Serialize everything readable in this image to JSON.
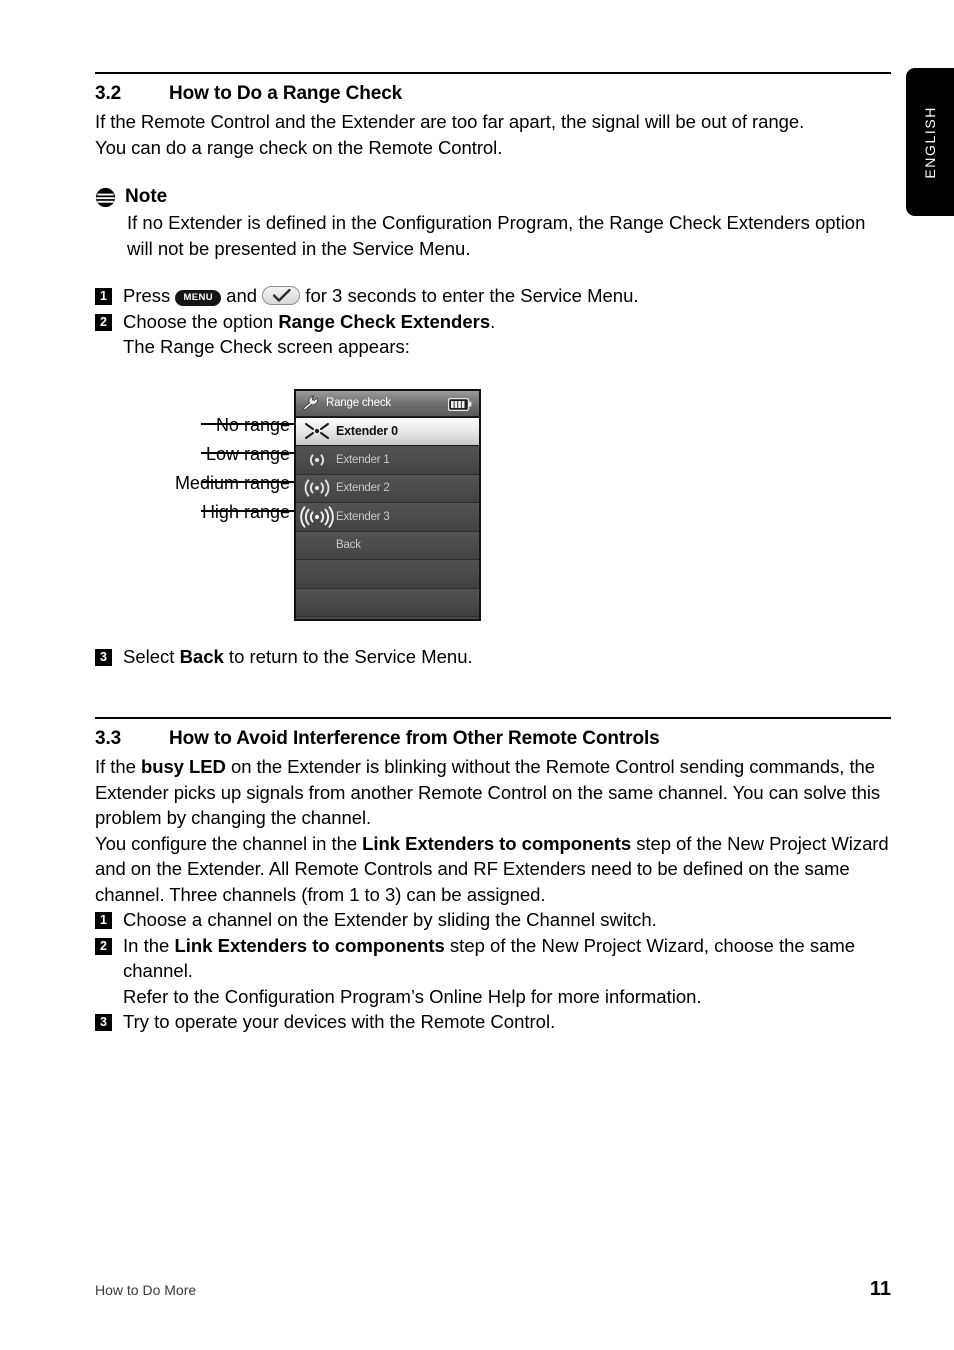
{
  "language_tab": {
    "label": "ENGLISH"
  },
  "section_32": {
    "number": "3.2",
    "title": "How to Do a Range Check",
    "intro_line1": "If the Remote Control and the Extender are too far apart, the signal will be out of range.",
    "intro_line2": "You can do a range check on the Remote Control.",
    "note": {
      "icon": "note-icon",
      "heading": "Note",
      "line1": "If no Extender is defined in the Configuration Program, the Range Check Extenders option",
      "line2": "will not be presented in the Service Menu."
    },
    "steps": [
      {
        "number": "1",
        "prefix": "Press ",
        "key_menu": "MENU",
        "middle": " and ",
        "key_ok": "ok-check-icon",
        "suffix": " for 3 seconds to enter the Service Menu."
      },
      {
        "number": "2",
        "prefix": "Choose the option ",
        "bold": "Range Check Extenders",
        "suffix": ".",
        "continuation": "The Range Check screen appears:"
      },
      {
        "number": "3",
        "prefix": "Select ",
        "bold": "Back",
        "suffix": " to return to the Service Menu."
      }
    ],
    "figure": {
      "callouts": [
        {
          "label": "No range"
        },
        {
          "label": "Low range"
        },
        {
          "label": "Medium range"
        },
        {
          "label": "High range"
        }
      ],
      "device": {
        "header_title": "Range check",
        "header_icon": "wrench-icon",
        "battery_icon": "battery-full-icon",
        "rows": [
          {
            "label": "Extender 0",
            "icon": "no-signal-icon",
            "selected": true
          },
          {
            "label": "Extender 1",
            "icon": "signal-low-icon",
            "selected": false
          },
          {
            "label": "Extender 2",
            "icon": "signal-medium-icon",
            "selected": false
          },
          {
            "label": "Extender 3",
            "icon": "signal-high-icon",
            "selected": false
          },
          {
            "label": "Back",
            "icon": "",
            "selected": false
          }
        ]
      }
    }
  },
  "section_33": {
    "number": "3.3",
    "title": "How to Avoid Interference from Other Remote Controls",
    "para1_a": "If the ",
    "para1_bold": "busy LED",
    "para1_b": " on the Extender is blinking without the Remote Control sending commands, the Extender picks up signals from another Remote Control on the same channel. You can solve this problem by changing the channel.",
    "para2_a": "You configure the channel in the ",
    "para2_bold": "Link Extenders to components",
    "para2_b": " step of the New Project Wizard and on the Extender. All Remote Controls and RF Extenders need to be defined on the same channel. Three channels (from 1 to 3) can be assigned.",
    "steps": [
      {
        "number": "1",
        "prefix": "Choose a channel on the Extender by sliding the Channel switch."
      },
      {
        "number": "2",
        "prefix": "In the ",
        "bold": "Link Extenders to components",
        "suffix": " step of the New Project Wizard, choose the same channel.",
        "continuation": "Refer to the Configuration Program’s Online Help for more information."
      },
      {
        "number": "3",
        "prefix": "Try to operate your devices with the Remote Control."
      }
    ]
  },
  "footer": {
    "left": "How to Do More",
    "page_number": "11"
  },
  "colors": {
    "text": "#000000",
    "rule": "#000000",
    "tab_bg": "#000000",
    "device_bg": "#4a4a4a",
    "device_row_text": "#c9c9c9"
  }
}
